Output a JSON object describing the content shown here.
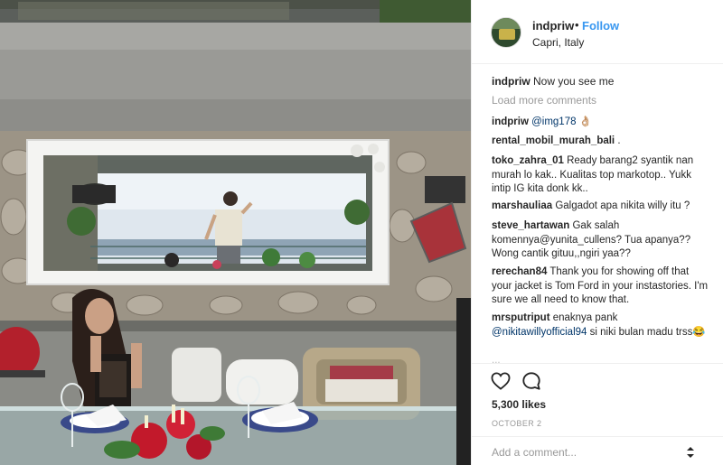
{
  "post": {
    "username": "indpriw",
    "dot": "•",
    "follow_label": "Follow",
    "location": "Capri, Italy"
  },
  "caption": {
    "user": "indpriw",
    "text": "Now you see me"
  },
  "load_more_label": "Load more comments",
  "comments": [
    {
      "user": "indpriw",
      "mention": "@img178",
      "text": " 👌🏼"
    },
    {
      "user": "rental_mobil_murah_bali",
      "mention": "",
      "text": " ."
    },
    {
      "user": "toko_zahra_01",
      "mention": "",
      "text": " Ready barang2 syantik nan murah lo kak.. Kualitas top markotop.. Yukk intip IG kita donk kk.."
    },
    {
      "user": "marshauliaa",
      "mention": "",
      "text": " Galgadot apa nikita willy itu ?"
    },
    {
      "user": "steve_hartawan",
      "mention": "",
      "text": " Gak salah komennya@yunita_cullens? Tua apanya?? Wong cantik gituu,,ngiri yaa??"
    },
    {
      "user": "rerechan84",
      "mention": "",
      "text": " Thank you for showing off that your jacket is Tom Ford in your instastories. I'm sure we all need to know that."
    },
    {
      "user": "mrsputriput",
      "mention": "",
      "text": " enaknya pank "
    },
    {
      "user": "",
      "mention": "@nikitawillyofficial94",
      "text": " si niki bulan madu trss😂"
    },
    {
      "user": "",
      "mention": "",
      "text": "..."
    }
  ],
  "likes_label": "5,300 likes",
  "date_label": "OCTOBER 2",
  "add_comment": {
    "placeholder": "Add a comment..."
  },
  "icons": {
    "like": "heart-icon",
    "comment": "comment-bubble-icon",
    "more": "more-options-icon"
  },
  "colors": {
    "link_blue": "#3897f0",
    "mention": "#003569",
    "muted": "#999999",
    "text": "#262626"
  }
}
